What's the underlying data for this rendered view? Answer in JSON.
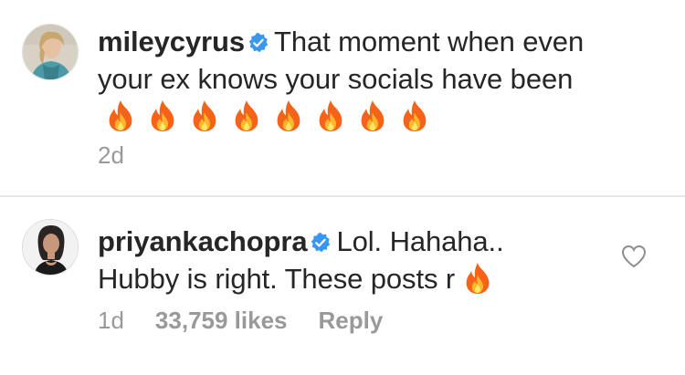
{
  "comments": [
    {
      "username": "mileycyrus",
      "verified": true,
      "text": "That moment when even your ex knows your socials have been",
      "fire_count": 8,
      "time": "2d"
    },
    {
      "username": "priyankachopra",
      "verified": true,
      "text": "Lol. Hahaha.. Hubby is right. These posts r",
      "fire_count": 1,
      "time": "1d",
      "likes": "33,759 likes",
      "reply_label": "Reply"
    }
  ],
  "icons": {
    "verified": "verified-badge-icon",
    "fire": "fire-emoji-icon",
    "like": "heart-outline-icon"
  },
  "colors": {
    "verified_blue": "#3897f0",
    "meta_gray": "#999999",
    "text": "#262626"
  }
}
